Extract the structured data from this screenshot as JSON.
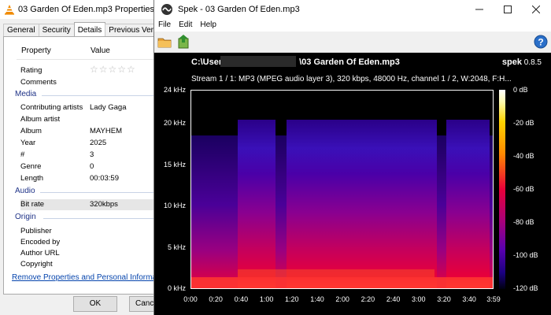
{
  "props": {
    "title": "03 Garden Of Eden.mp3 Properties",
    "tabs": [
      "General",
      "Security",
      "Details",
      "Previous Versions"
    ],
    "header": {
      "property": "Property",
      "value": "Value"
    },
    "rows_top": [
      {
        "k": "Rating",
        "v": "☆☆☆☆☆"
      },
      {
        "k": "Comments",
        "v": ""
      }
    ],
    "section_media": "Media",
    "rows_media": [
      {
        "k": "Contributing artists",
        "v": "Lady Gaga"
      },
      {
        "k": "Album artist",
        "v": ""
      },
      {
        "k": "Album",
        "v": "MAYHEM"
      },
      {
        "k": "Year",
        "v": "2025"
      },
      {
        "k": "#",
        "v": "3"
      },
      {
        "k": "Genre",
        "v": "0"
      },
      {
        "k": "Length",
        "v": "00:03:59"
      }
    ],
    "section_audio": "Audio",
    "rows_audio": [
      {
        "k": "Bit rate",
        "v": "320kbps"
      }
    ],
    "section_origin": "Origin",
    "rows_origin": [
      {
        "k": "Publisher",
        "v": ""
      },
      {
        "k": "Encoded by",
        "v": ""
      },
      {
        "k": "Author URL",
        "v": ""
      },
      {
        "k": "Copyright",
        "v": ""
      }
    ],
    "link": "Remove Properties and Personal Information",
    "ok": "OK",
    "cancel": "Cancel"
  },
  "spek": {
    "title": "Spek - 03 Garden Of Eden.mp3",
    "menu": [
      "File",
      "Edit",
      "Help"
    ],
    "file_prefix": "C:\\User",
    "file_suffix": "\\03 Garden Of Eden.mp3",
    "app_name": "spek",
    "version": "0.8.5",
    "stream_info": "Stream 1 / 1: MP3 (MPEG audio layer 3), 320 kbps, 48000 Hz, channel 1 / 2, W:2048, F:H...",
    "freq_labels": [
      "24 kHz",
      "20 kHz",
      "15 kHz",
      "10 kHz",
      "5 kHz",
      "0 kHz"
    ],
    "time_labels": [
      "0:00",
      "0:20",
      "0:40",
      "1:00",
      "1:20",
      "1:40",
      "2:00",
      "2:20",
      "2:40",
      "3:00",
      "3:20",
      "3:40",
      "3:59"
    ],
    "db_labels": [
      "0 dB",
      "-20 dB",
      "-40 dB",
      "-60 dB",
      "-80 dB",
      "-100 dB",
      "-120 dB"
    ]
  },
  "colors": {
    "accent_link": "#0645ad",
    "section": "#1e3287",
    "spectrum_high": "#ffd400",
    "spectrum_mid": "#e8003a",
    "spectrum_low": "#5a00b0"
  }
}
